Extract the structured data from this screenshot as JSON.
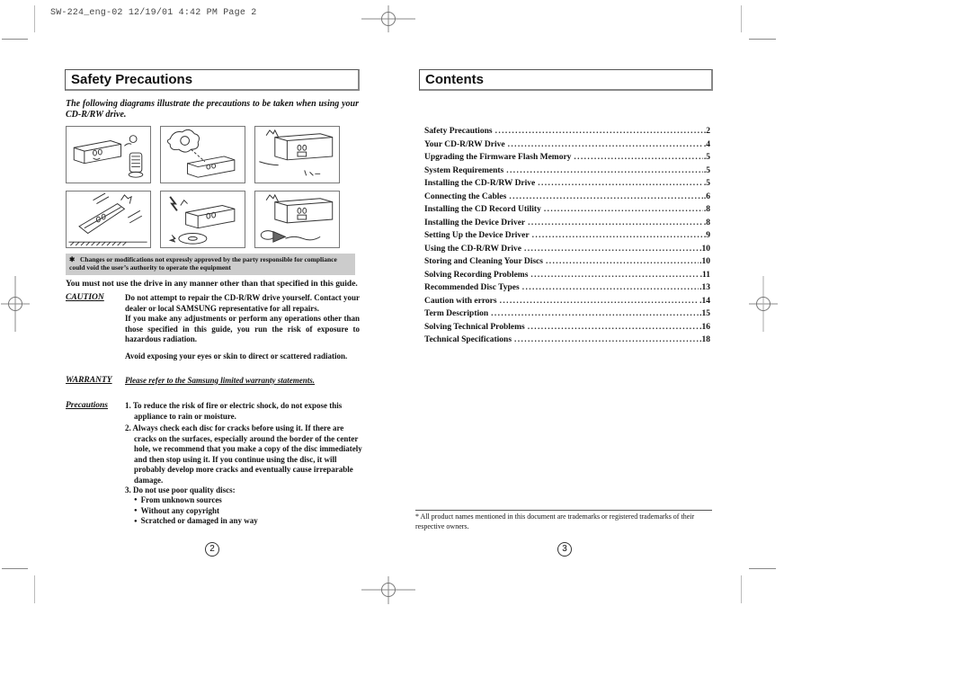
{
  "print_header": "SW-224_eng-02  12/19/01 4:42 PM  Page 2",
  "left_page": {
    "title": "Safety Precautions",
    "intro": "The following diagrams illustrate the precautions to be taken when using your CD-R/RW drive.",
    "illustrations": [
      {
        "icon": "drive-near-heater-illustration"
      },
      {
        "icon": "drive-in-sunlight-illustration"
      },
      {
        "icon": "drive-disassembly-illustration"
      },
      {
        "icon": "drive-dropped-illustration"
      },
      {
        "icon": "drive-disc-broken-illustration"
      },
      {
        "icon": "drive-liquid-spill-illustration"
      }
    ],
    "notice": {
      "symbol": "✱",
      "text": "Changes or modifications not expressly approved by the party responsible for compliance could void the user’s authority to operate the equipment"
    },
    "usage_statement": "You must not use the drive in any manner other than that specified in this guide.",
    "caution": {
      "label": "CAUTION",
      "text1": "Do not attempt to repair the CD-R/RW drive yourself. Contact your dealer or local SAMSUNG representative for all repairs.",
      "text2": "If you make any adjustments or perform any operations other than those specified in this guide, you run the risk of exposure to hazardous radiation.",
      "text3": "Avoid exposing your eyes or skin to direct or scattered radiation."
    },
    "warranty": {
      "label": "WARRANTY",
      "text": "Please refer to the Samsung limited warranty statements."
    },
    "precautions": {
      "label": "Precautions",
      "items": [
        "1. To reduce the risk of fire or electric shock, do not expose this appliance to rain or moisture.",
        "2. Always check each disc for cracks before using it. If there are cracks on the surfaces, especially around the border of the center hole, we recommend that you make a copy of the disc immediately and then stop using it. If you continue using the disc, it will probably develop more cracks and eventually cause irreparable damage.",
        "3. Do not use poor quality discs:"
      ],
      "bullets": [
        "From unknown sources",
        "Without any copyright",
        "Scratched or damaged in any way"
      ]
    },
    "page_number": "2"
  },
  "right_page": {
    "title": "Contents",
    "toc": [
      {
        "title": "Safety Precautions",
        "page": ".2"
      },
      {
        "title": "Your CD-R/RW Drive",
        "page": ".4"
      },
      {
        "title": "Upgrading the Firmware Flash Memory",
        "page": ".5"
      },
      {
        "title": "System Requirements",
        "page": ".5"
      },
      {
        "title": "Installing the CD-R/RW Drive",
        "page": ".5"
      },
      {
        "title": "Connecting the Cables",
        "page": ".6"
      },
      {
        "title": "Installing the CD Record Utility",
        "page": ".8"
      },
      {
        "title": "Installing the Device Driver",
        "page": ".8"
      },
      {
        "title": "Setting Up the Device Driver",
        "page": ".9"
      },
      {
        "title": "Using the CD-R/RW Drive",
        "page": ".10"
      },
      {
        "title": "Storing and Cleaning Your Discs",
        "page": ".10"
      },
      {
        "title": "Solving Recording Problems",
        "page": ".11"
      },
      {
        "title": "Recommended Disc Types",
        "page": ".13"
      },
      {
        "title": "Caution with errors",
        "page": ".14"
      },
      {
        "title": "Term Description",
        "page": ".15"
      },
      {
        "title": "Solving Technical Problems",
        "page": ".16"
      },
      {
        "title": "Technical Specifications",
        "page": ".18"
      }
    ],
    "footnote": "* All product names mentioned in this document are trademarks or registered trademarks of their respective owners.",
    "page_number": "3"
  }
}
